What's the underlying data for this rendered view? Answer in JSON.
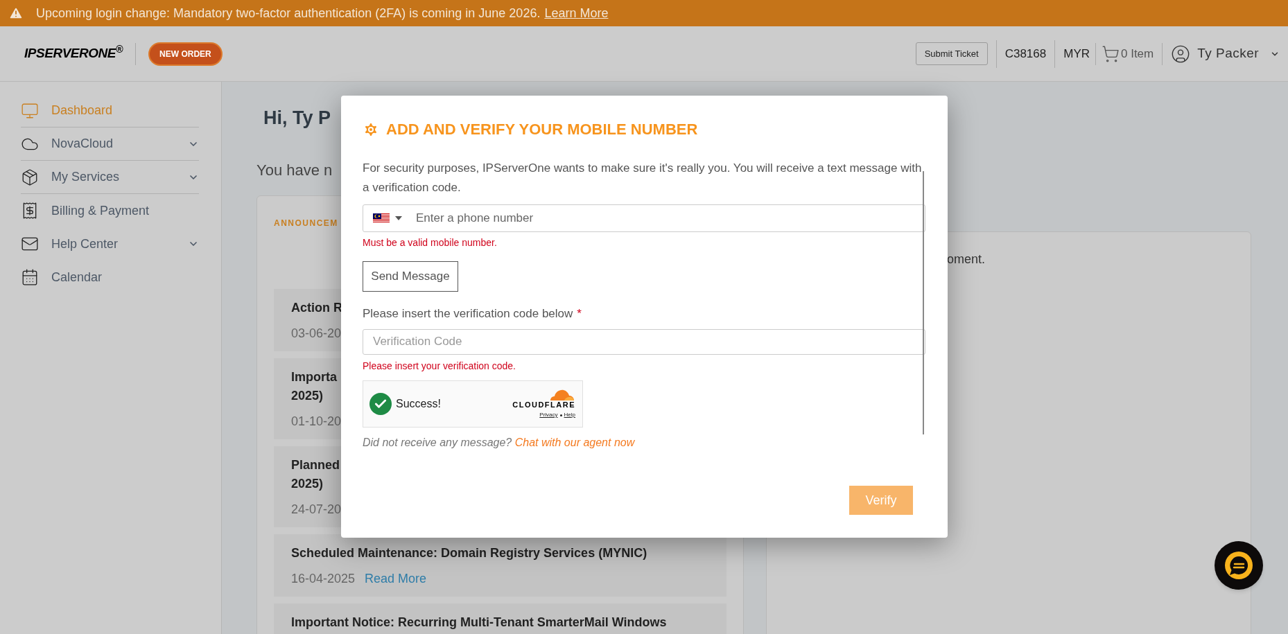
{
  "banner": {
    "text": "Upcoming login change: Mandatory two-factor authentication (2FA) is coming in June 2026.",
    "link": "Learn More"
  },
  "header": {
    "logo": "IPSERVERONE$^{®}$",
    "new_order": "NEW ORDER",
    "submit_ticket": "Submit Ticket",
    "account_id": "C38168",
    "currency": "MYR",
    "cart": "0 Item",
    "user": "Ty Packer"
  },
  "sidebar": {
    "items": [
      {
        "label": "Dashboard",
        "kind": "monitor",
        "selected": true,
        "expandable": false
      },
      {
        "label": "NovaCloud",
        "kind": "cloud",
        "selected": false,
        "expandable": true
      },
      {
        "label": "My Services",
        "kind": "package",
        "selected": false,
        "expandable": true
      },
      {
        "label": "Billing & Payment",
        "kind": "receipt",
        "selected": false,
        "expandable": false
      },
      {
        "label": "Help Center",
        "kind": "mail",
        "selected": false,
        "expandable": true
      },
      {
        "label": "Calendar",
        "kind": "calendar",
        "selected": false,
        "expandable": false
      }
    ]
  },
  "main": {
    "greeting": "Hi, Ty P",
    "notice": "You have n",
    "announcements_tab": "ANNOUNCEM",
    "announcements": [
      {
        "title_lines": [
          "Action R"
        ],
        "date": "03-06-20"
      },
      {
        "title_lines": [
          "Importa",
          "2025)"
        ],
        "date": "01-10-20"
      },
      {
        "title_lines": [
          "Planned",
          "2025)"
        ],
        "date": "24-07-20"
      },
      {
        "title_lines": [
          "Scheduled Maintenance: Domain Registry Services (MYNIC)"
        ],
        "date": "16-04-2025",
        "link": "Read More"
      },
      {
        "title_lines": [
          "Important Notice: Recurring Multi-Tenant SmarterMail Windows"
        ]
      }
    ],
    "side_card_text": "oment."
  },
  "modal": {
    "title": "ADD AND VERIFY YOUR MOBILE NUMBER",
    "description": "For security purposes, IPServerOne wants to make sure it's really you. You will receive a text message with a verification code.",
    "phone": {
      "placeholder": "Enter a phone number",
      "error": "Must be a valid mobile number."
    },
    "send_button": "Send Message",
    "code_label": "Please insert the verification code below",
    "required_mark": "*",
    "code": {
      "placeholder": "Verification Code",
      "error": "Please insert your verification code."
    },
    "captcha": {
      "status": "Success!",
      "brand": "CLOUDFLARE",
      "links": [
        "Privacy",
        "Help"
      ]
    },
    "help_text": "Did not receive any message?",
    "help_link": "Chat with our agent now",
    "verify": {
      "label": "Verify",
      "disabled": true
    }
  }
}
